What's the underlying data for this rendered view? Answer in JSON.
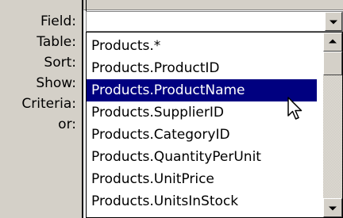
{
  "labels": [
    "Field:",
    "Table:",
    "Sort:",
    "Show:",
    "Criteria:",
    "or:"
  ],
  "field_value": "",
  "dropdown": {
    "items": [
      "Products.*",
      "Products.ProductID",
      "Products.ProductName",
      "Products.SupplierID",
      "Products.CategoryID",
      "Products.QuantityPerUnit",
      "Products.UnitPrice",
      "Products.UnitsInStock"
    ],
    "selected_index": 2
  },
  "icons": {
    "combo_arrow": "chevron-down-icon",
    "scroll_up": "scroll-up-arrow-icon",
    "scroll_down": "scroll-down-arrow-icon",
    "cursor": "mouse-pointer-icon"
  },
  "colors": {
    "selection": "#000080",
    "face": "#d4d0c8"
  }
}
